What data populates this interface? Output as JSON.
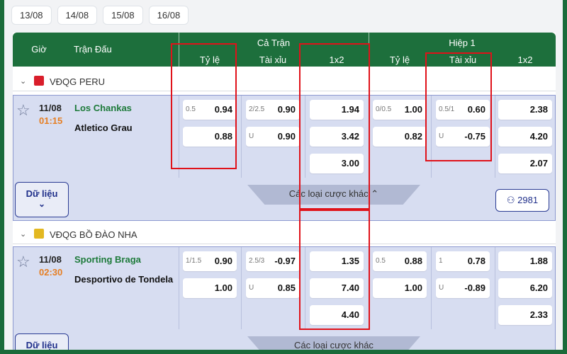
{
  "dates": [
    "13/08",
    "14/08",
    "15/08",
    "16/08"
  ],
  "header": {
    "col_time": "Giờ",
    "col_match": "Trận Đấu",
    "group_full": "Cả Trận",
    "group_half": "Hiệp 1",
    "sub_ratio": "Tỷ lệ",
    "sub_ou": "Tài xỉu",
    "sub_1x2": "1x2"
  },
  "leagues": [
    {
      "name": "VĐQG PERU",
      "match": {
        "date": "11/08",
        "time": "01:15",
        "home": "Los Chankas",
        "away": "Atletico Grau",
        "ft_hdp": [
          {
            "label": "0.5",
            "value": "0.94"
          },
          {
            "label": "",
            "value": "0.88"
          }
        ],
        "ft_ou": [
          {
            "label": "2/2.5",
            "value": "0.90"
          },
          {
            "label": "U",
            "value": "0.90"
          }
        ],
        "ft_1x2": [
          "1.94",
          "3.42",
          "3.00"
        ],
        "h1_hdp": [
          {
            "label": "0/0.5",
            "value": "1.00"
          },
          {
            "label": "",
            "value": "0.82"
          }
        ],
        "h1_ou": [
          {
            "label": "0.5/1",
            "value": "0.60"
          },
          {
            "label": "U",
            "value": "-0.75"
          }
        ],
        "h1_1x2": [
          "2.38",
          "4.20",
          "2.07"
        ],
        "data_label": "Dữ liệu",
        "more_label": "Các loại cược khác",
        "count": "2981"
      }
    },
    {
      "name": "VĐQG BỒ ĐÀO NHA",
      "match": {
        "date": "11/08",
        "time": "02:30",
        "home": "Sporting Braga",
        "away": "Desportivo de Tondela",
        "ft_hdp": [
          {
            "label": "1/1.5",
            "value": "0.90"
          },
          {
            "label": "",
            "value": "1.00"
          }
        ],
        "ft_ou": [
          {
            "label": "2.5/3",
            "value": "-0.97"
          },
          {
            "label": "U",
            "value": "0.85"
          }
        ],
        "ft_1x2": [
          "1.35",
          "7.40",
          "4.40"
        ],
        "h1_hdp": [
          {
            "label": "0.5",
            "value": "0.88"
          },
          {
            "label": "",
            "value": "1.00"
          }
        ],
        "h1_ou": [
          {
            "label": "1",
            "value": "0.78"
          },
          {
            "label": "U",
            "value": "-0.89"
          }
        ],
        "h1_1x2": [
          "1.88",
          "6.20",
          "2.33"
        ],
        "data_label": "Dữ liệu",
        "more_label": "Các loại cược khác"
      }
    }
  ],
  "colors": {
    "header_bg": "#1d6f3c",
    "highlight": "#e0121a",
    "home_team": "#1d7a3a",
    "time": "#e67e22"
  }
}
